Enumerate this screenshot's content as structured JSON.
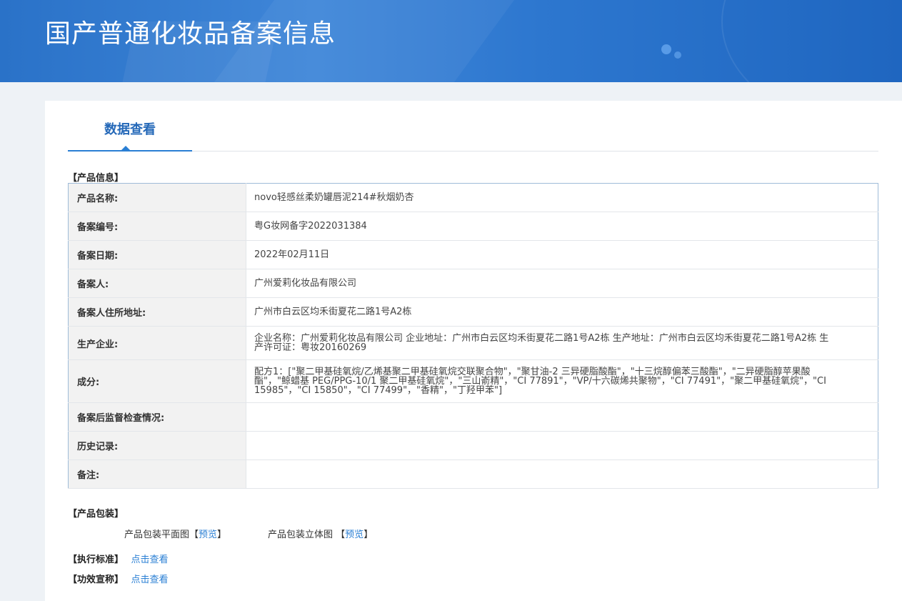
{
  "header": {
    "title": "国产普通化妆品备案信息"
  },
  "tabs": [
    {
      "label": "数据查看"
    }
  ],
  "sections": {
    "product_info": "【产品信息】",
    "packaging": "【产品包装】",
    "standard": "【执行标准】",
    "efficacy": "【功效宣称】"
  },
  "product_table": {
    "rows": [
      {
        "key": "产品名称:",
        "value": "novo轻感丝柔奶罐唇泥214#秋烟奶杏"
      },
      {
        "key": "备案编号:",
        "value": "粤G妆网备字2022031384"
      },
      {
        "key": "备案日期:",
        "value": "2022年02月11日"
      },
      {
        "key": "备案人:",
        "value": "广州爱莉化妆品有限公司"
      },
      {
        "key": "备案人住所地址:",
        "value": "广州市白云区均禾街夏花二路1号A2栋"
      },
      {
        "key": "生产企业:",
        "value": "企业名称：广州爱莉化妆品有限公司 企业地址：广州市白云区均禾街夏花二路1号A2栋 生产地址：广州市白云区均禾街夏花二路1号A2栋 生产许可证：粤妆20160269"
      },
      {
        "key": "成分:",
        "value": "配方1：[\"聚二甲基硅氧烷/乙烯基聚二甲基硅氧烷交联聚合物\"，\"聚甘油-2 三异硬脂酸酯\"，\"十三烷醇偏苯三酸酯\"，\"二异硬脂醇苹果酸酯\"，\"鲸蜡基 PEG/PPG-10/1 聚二甲基硅氧烷\"，\"三山嵛精\"，\"CI 77891\"，\"VP/十六碳烯共聚物\"，\"CI 77491\"，\"聚二甲基硅氧烷\"，\"CI 15985\"，\"CI 15850\"，\"CI 77499\"，\"香精\"，\"丁羟甲苯\"]"
      },
      {
        "key": "备案后监督检查情况:",
        "value": ""
      },
      {
        "key": "历史记录:",
        "value": ""
      },
      {
        "key": "备注:",
        "value": ""
      }
    ]
  },
  "packaging": {
    "flat_label": "产品包装平面图",
    "flat_link": "预览",
    "solid_label": "产品包装立体图",
    "solid_link": "预览",
    "bracket_open": "【",
    "bracket_close": "】"
  },
  "links": {
    "standard_view": "点击查看",
    "efficacy_view": "点击查看"
  }
}
